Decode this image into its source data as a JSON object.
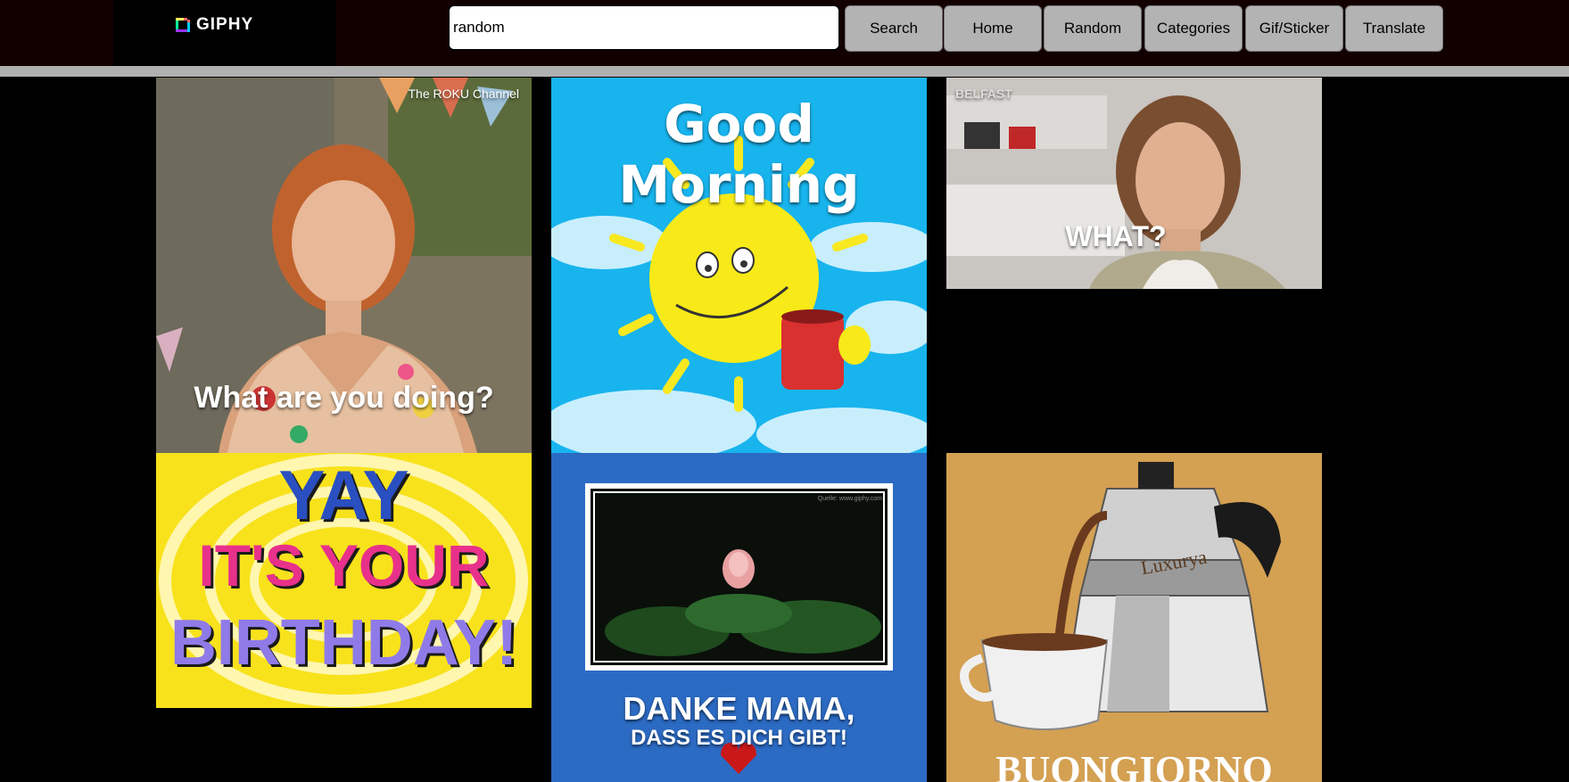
{
  "header": {
    "logo_text": "GIPHY",
    "search_value": "random",
    "buttons": {
      "search": "Search",
      "home": "Home",
      "random": "Random",
      "categories": "Categories",
      "gif_sticker": "Gif/Sticker",
      "translate": "Translate"
    }
  },
  "gifs": [
    {
      "watermark": "The ROKU Channel",
      "caption": "What are you doing?"
    },
    {
      "caption": "Good Morning"
    },
    {
      "watermark": "BELFAST",
      "caption": "WHAT?"
    },
    {
      "caption_line1": "YAY",
      "caption_line2": "IT'S YOUR",
      "caption_line3": "BIRTHDAY!"
    },
    {
      "source": "Quelle: www.giphy.com",
      "caption_line1": "DANKE MAMA,",
      "caption_line2": "DASS ES DICH GIBT!"
    },
    {
      "brand": "Luxurya",
      "caption": "BUONGIORNO"
    }
  ],
  "colors": {
    "topbar": "#120000",
    "button_bg": "#b3b3b3",
    "divider": "#b0b0b0"
  }
}
